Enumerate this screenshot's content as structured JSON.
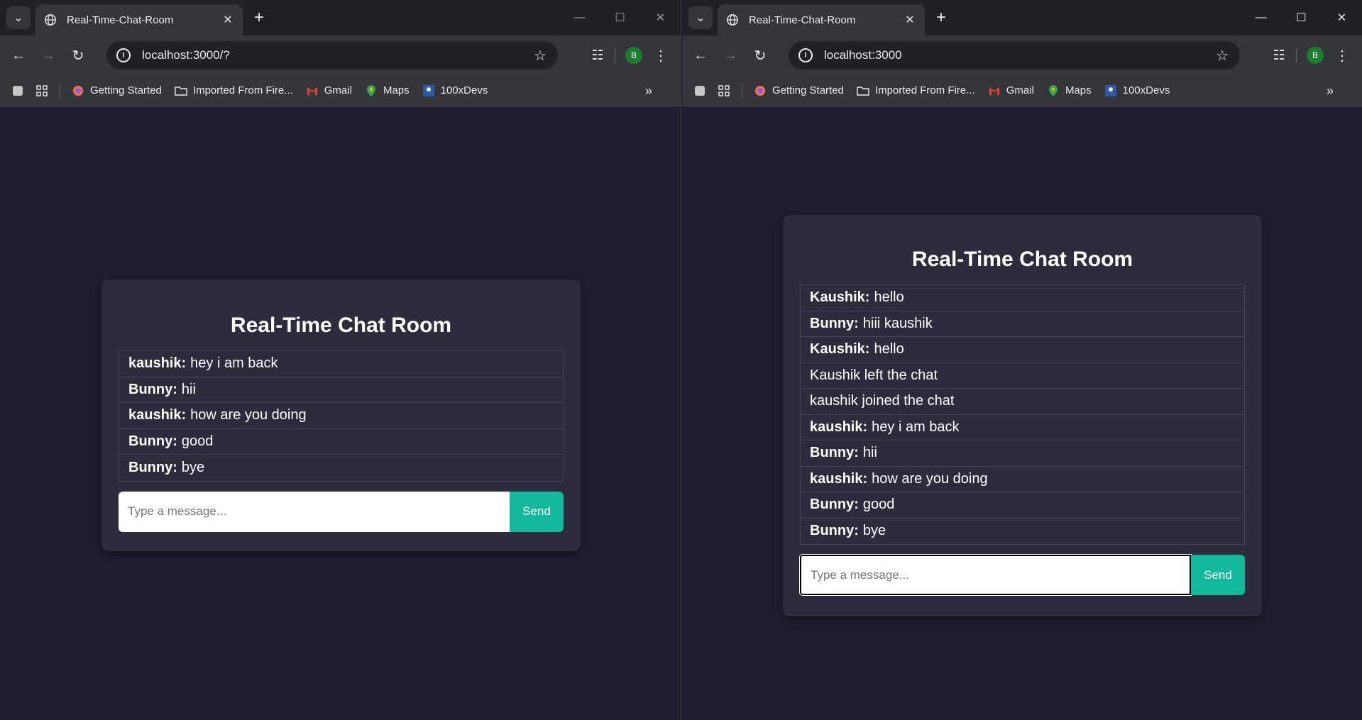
{
  "browser": {
    "tab_title": "Real-Time-Chat-Room",
    "bookmarks": [
      {
        "label": "Getting Started",
        "icon": "firefox-icon"
      },
      {
        "label": "Imported From Fire...",
        "icon": "folder-icon"
      },
      {
        "label": "Gmail",
        "icon": "gmail-icon"
      },
      {
        "label": "Maps",
        "icon": "maps-icon"
      },
      {
        "label": "100xDevs",
        "icon": "100xdevs-icon"
      }
    ],
    "profile_initial": "B",
    "accent_avatar": "#1e7c31"
  },
  "left": {
    "url": "localhost:3000/?",
    "chat": {
      "title": "Real-Time Chat Room",
      "messages": [
        {
          "user": "kaushik:",
          "text": "hey i am back"
        },
        {
          "user": "Bunny:",
          "text": "hii"
        },
        {
          "user": "kaushik:",
          "text": "how are you doing"
        },
        {
          "user": "Bunny:",
          "text": "good"
        },
        {
          "user": "Bunny:",
          "text": "bye"
        }
      ],
      "placeholder": "Type a message...",
      "send_label": "Send"
    }
  },
  "right": {
    "url": "localhost:3000",
    "chat": {
      "title": "Real-Time Chat Room",
      "messages": [
        {
          "user": "Kaushik:",
          "text": "hello"
        },
        {
          "user": "Bunny:",
          "text": "hiii kaushik"
        },
        {
          "user": "Kaushik:",
          "text": "hello"
        },
        {
          "user": "",
          "text": "Kaushik left the chat"
        },
        {
          "user": "",
          "text": "kaushik joined the chat"
        },
        {
          "user": "kaushik:",
          "text": "hey i am back"
        },
        {
          "user": "Bunny:",
          "text": "hii"
        },
        {
          "user": "kaushik:",
          "text": "how are you doing"
        },
        {
          "user": "Bunny:",
          "text": "good"
        },
        {
          "user": "Bunny:",
          "text": "bye"
        }
      ],
      "placeholder": "Type a message...",
      "send_label": "Send"
    }
  },
  "colors": {
    "page_bg": "#1f1f30",
    "card_bg": "#2c2c3c",
    "send_button": "#14b89b"
  }
}
